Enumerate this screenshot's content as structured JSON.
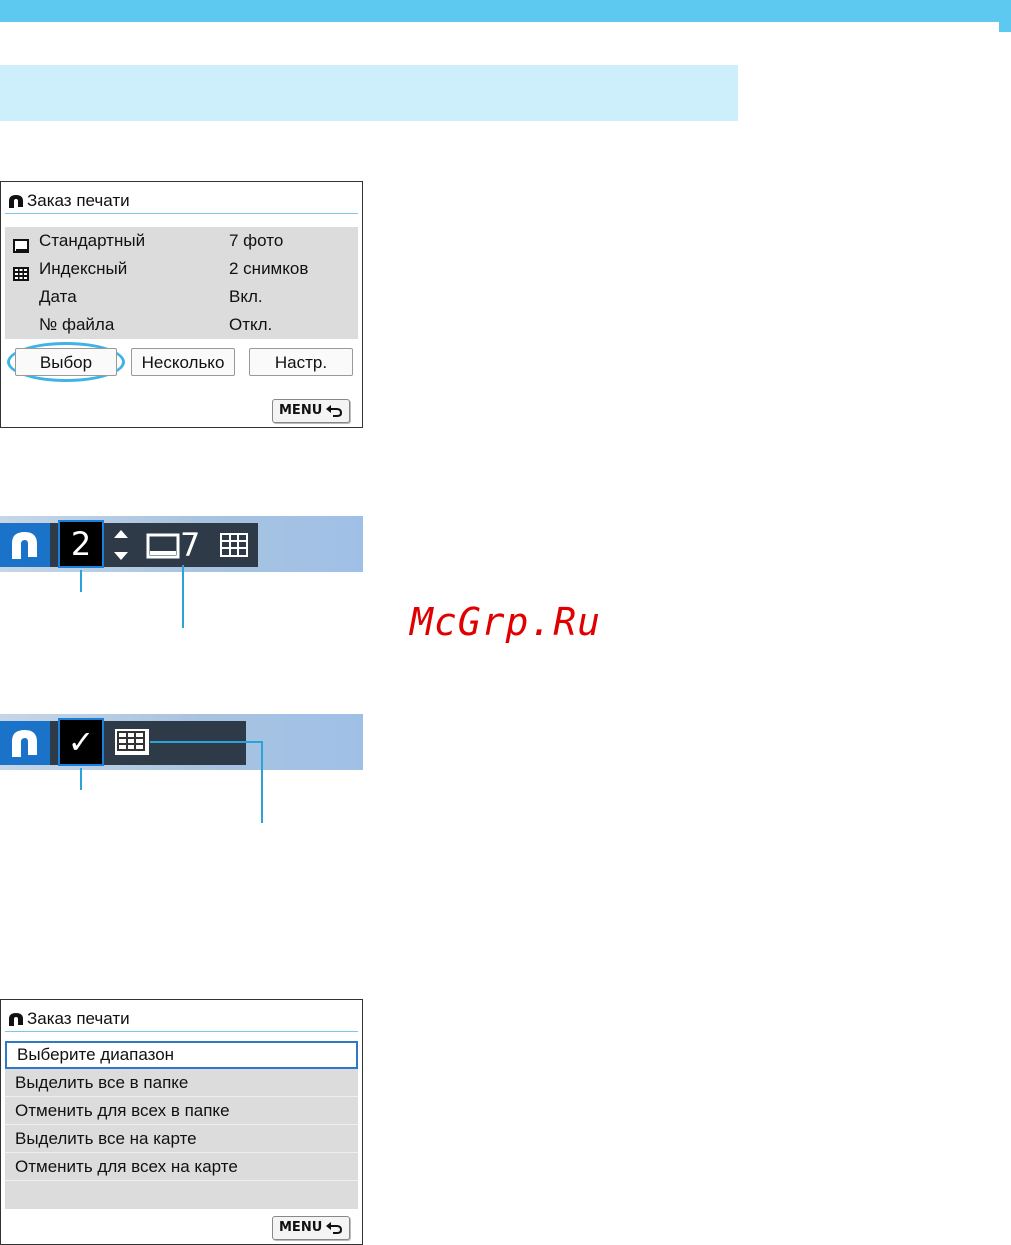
{
  "print_order_screen": {
    "title": "Заказ печати",
    "rows": [
      {
        "label": "Стандартный",
        "value": "7 фото",
        "icon": "standard-print-icon"
      },
      {
        "label": "Индексный",
        "value": "2 снимков",
        "icon": "index-print-icon"
      },
      {
        "label": "Дата",
        "value": "Вкл.",
        "icon": ""
      },
      {
        "label": "№ файла",
        "value": "Откл.",
        "icon": ""
      }
    ],
    "buttons": {
      "select": "Выбор",
      "multiple": "Несколько",
      "setup": "Настр."
    },
    "menu_button": "MENU"
  },
  "strip_quantity": {
    "quantity": "2",
    "standard_count": "7"
  },
  "strip_index": {
    "check": "✓"
  },
  "range_screen": {
    "title": "Заказ печати",
    "items": [
      "Выберите диапазон",
      "Выделить все в папке",
      "Отменить для всех в папке",
      "Выделить все на карте",
      "Отменить для всех на карте"
    ],
    "menu_button": "MENU"
  },
  "watermark": "McGrp.Ru",
  "colors": {
    "accent": "#5ec9f0",
    "band": "#cdeefb",
    "callout": "#2aa3d8",
    "selection": "#2d78c8",
    "watermark": "#e00000"
  }
}
